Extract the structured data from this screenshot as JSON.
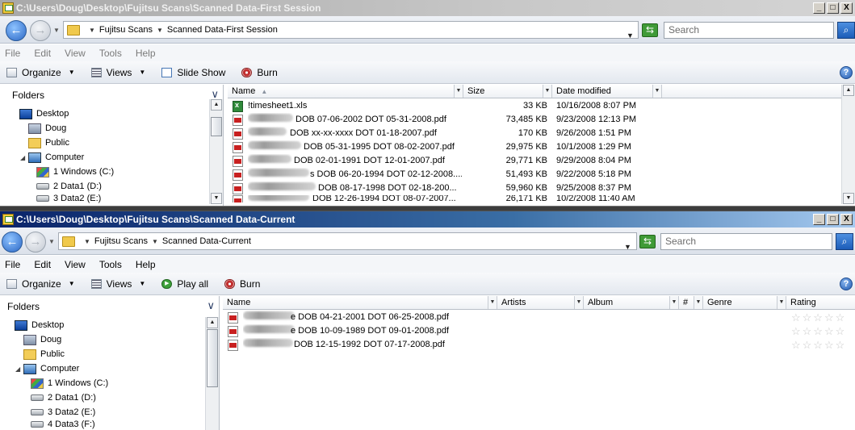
{
  "windows": [
    {
      "title": "C:\\Users\\Doug\\Desktop\\Fujitsu Scans\\Scanned Data-First Session",
      "breadcrumbs": [
        "Fujitsu Scans",
        "Scanned Data-First Session"
      ],
      "search_placeholder": "Search",
      "menu": [
        "File",
        "Edit",
        "View",
        "Tools",
        "Help"
      ],
      "toolbar": [
        {
          "label": "Organize",
          "icon": "organize-icon",
          "dropdown": true
        },
        {
          "label": "Views",
          "icon": "views-icon",
          "dropdown": true
        },
        {
          "label": "Slide Show",
          "icon": "slideshow-icon",
          "dropdown": false
        },
        {
          "label": "Burn",
          "icon": "burn-icon",
          "dropdown": false
        }
      ],
      "folders_label": "Folders",
      "tree": [
        "Desktop",
        "Doug",
        "Public",
        "Computer",
        "1 Windows (C:)",
        "2 Data1 (D:)",
        "3 Data2 (E:)"
      ],
      "columns": [
        "Name",
        "Size",
        "Date modified"
      ],
      "files": [
        {
          "name": "!timesheet1.xls",
          "size": "33 KB",
          "date": "10/16/2008 8:07 PM",
          "type": "xls"
        },
        {
          "name": "DOB 07-06-2002 DOT 05-31-2008.pdf",
          "size": "73,485 KB",
          "date": "9/23/2008 12:13 PM",
          "type": "pdf"
        },
        {
          "name": "DOB xx-xx-xxxx DOT 01-18-2007.pdf",
          "size": "170 KB",
          "date": "9/26/2008 1:51 PM",
          "type": "pdf"
        },
        {
          "name": "DOB 05-31-1995 DOT 08-02-2007.pdf",
          "size": "29,975 KB",
          "date": "10/1/2008 1:29 PM",
          "type": "pdf"
        },
        {
          "name": "DOB 02-01-1991 DOT 12-01-2007.pdf",
          "size": "29,771 KB",
          "date": "9/29/2008 8:04 PM",
          "type": "pdf"
        },
        {
          "name": "s DOB 06-20-1994 DOT 02-12-2008....",
          "size": "51,493 KB",
          "date": "9/22/2008 5:18 PM",
          "type": "pdf"
        },
        {
          "name": "DOB 08-17-1998 DOT 02-18-200...",
          "size": "59,960 KB",
          "date": "9/25/2008 8:37 PM",
          "type": "pdf"
        },
        {
          "name": "DOB 12-26-1994 DOT 08-07-2007...",
          "size": "26,171 KB",
          "date": "10/2/2008 11:40 AM",
          "type": "pdf"
        }
      ]
    },
    {
      "title": "C:\\Users\\Doug\\Desktop\\Fujitsu Scans\\Scanned Data-Current",
      "breadcrumbs": [
        "Fujitsu Scans",
        "Scanned Data-Current"
      ],
      "search_placeholder": "Search",
      "menu": [
        "File",
        "Edit",
        "View",
        "Tools",
        "Help"
      ],
      "toolbar": [
        {
          "label": "Organize",
          "icon": "organize-icon",
          "dropdown": true
        },
        {
          "label": "Views",
          "icon": "views-icon",
          "dropdown": true
        },
        {
          "label": "Play all",
          "icon": "play-icon",
          "dropdown": false
        },
        {
          "label": "Burn",
          "icon": "burn-icon",
          "dropdown": false
        }
      ],
      "folders_label": "Folders",
      "tree": [
        "Desktop",
        "Doug",
        "Public",
        "Computer",
        "1 Windows (C:)",
        "2 Data1 (D:)",
        "3 Data2 (E:)",
        "4 Data3 (F:)"
      ],
      "columns": [
        "Name",
        "Artists",
        "Album",
        "#",
        "Genre",
        "Rating"
      ],
      "files": [
        {
          "name": "e DOB 04-21-2001 DOT 06-25-2008.pdf",
          "type": "pdf"
        },
        {
          "name": "e DOB 10-09-1989 DOT 09-01-2008.pdf",
          "type": "pdf"
        },
        {
          "name": "DOB 12-15-1992 DOT 07-17-2008.pdf",
          "type": "pdf"
        }
      ]
    }
  ],
  "title_buttons": [
    "_",
    "□",
    "X"
  ],
  "colors": {
    "active_title": "#0a246a",
    "inactive_title": "#a8a8a8"
  }
}
